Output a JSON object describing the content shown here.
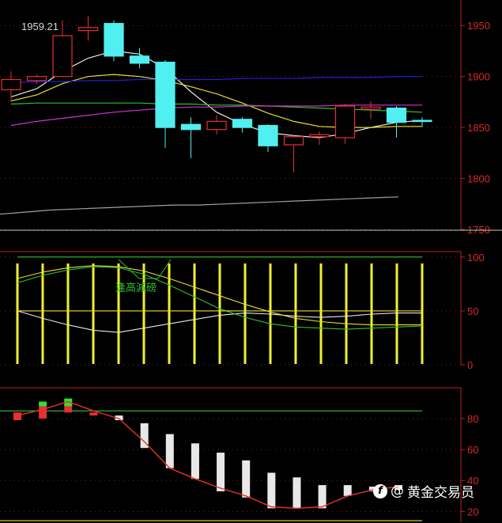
{
  "watermark": {
    "at": "@",
    "name": "黄金交易员",
    "logo_glyph": "f"
  },
  "colors": {
    "up_candle": "#e83030",
    "down_candle": "#50f0f0",
    "axis": "#c02020",
    "ma_white": "#e8e8e8",
    "ma_yellow": "#e8e030",
    "ma_blue": "#2020e0",
    "ma_green": "#30c030",
    "ma_magenta": "#d030d0",
    "ma_gray": "#a0a0a0"
  },
  "chart_data": [
    {
      "type": "candlestick",
      "title": "",
      "annotation": "1959.21",
      "ylim": [
        1750,
        1975
      ],
      "yticks": [
        1950,
        1900,
        1850,
        1800,
        1750
      ],
      "candles": [
        {
          "o": 1887,
          "h": 1905,
          "l": 1875,
          "c": 1897
        },
        {
          "o": 1896,
          "h": 1902,
          "l": 1893,
          "c": 1900
        },
        {
          "o": 1900,
          "h": 1955,
          "l": 1900,
          "c": 1940
        },
        {
          "o": 1945,
          "h": 1959.21,
          "l": 1935,
          "c": 1948
        },
        {
          "o": 1952,
          "h": 1955,
          "l": 1915,
          "c": 1920
        },
        {
          "o": 1920,
          "h": 1928,
          "l": 1908,
          "c": 1913
        },
        {
          "o": 1914,
          "h": 1916,
          "l": 1830,
          "c": 1850
        },
        {
          "o": 1853,
          "h": 1860,
          "l": 1820,
          "c": 1848
        },
        {
          "o": 1848,
          "h": 1862,
          "l": 1843,
          "c": 1856
        },
        {
          "o": 1858,
          "h": 1860,
          "l": 1845,
          "c": 1850
        },
        {
          "o": 1852,
          "h": 1853,
          "l": 1826,
          "c": 1832
        },
        {
          "o": 1833,
          "h": 1843,
          "l": 1806,
          "c": 1841
        },
        {
          "o": 1841,
          "h": 1846,
          "l": 1833,
          "c": 1843
        },
        {
          "o": 1840,
          "h": 1873,
          "l": 1834,
          "c": 1871
        },
        {
          "o": 1868,
          "h": 1876,
          "l": 1858,
          "c": 1870
        },
        {
          "o": 1869,
          "h": 1871,
          "l": 1840,
          "c": 1855
        },
        {
          "o": 1857,
          "h": 1860,
          "l": 1851,
          "c": 1856
        }
      ],
      "series": [
        {
          "color": "ma_white",
          "values": [
            1880,
            1888,
            1905,
            1918,
            1925,
            1922,
            1908,
            1885,
            1865,
            1853,
            1845,
            1842,
            1840,
            1844,
            1850,
            1855,
            1857
          ]
        },
        {
          "color": "ma_yellow",
          "values": [
            1876,
            1882,
            1893,
            1900,
            1902,
            1900,
            1896,
            1890,
            1883,
            1874,
            1864,
            1856,
            1851,
            1850,
            1850,
            1851,
            1851
          ]
        },
        {
          "color": "ma_blue",
          "values": [
            1894,
            1895,
            1895,
            1896,
            1896,
            1897,
            1897,
            1897,
            1897,
            1898,
            1898,
            1898,
            1899,
            1899,
            1899,
            1900,
            1900
          ]
        },
        {
          "color": "ma_green",
          "values": [
            1873,
            1874,
            1874,
            1874,
            1874,
            1874,
            1873,
            1873,
            1872,
            1872,
            1871,
            1870,
            1869,
            1868,
            1867,
            1866,
            1865
          ]
        },
        {
          "color": "ma_magenta",
          "values": [
            1852,
            1856,
            1859,
            1862,
            1865,
            1867,
            1869,
            1870,
            1870,
            1871,
            1871,
            1871,
            1871,
            1872,
            1872,
            1872,
            1872
          ]
        },
        {
          "color": "ma_gray",
          "values": [
            1765,
            1767,
            1769,
            1770,
            1771,
            1772,
            1773,
            1774,
            1774,
            1775,
            1776,
            1777,
            1778,
            1779,
            1780,
            1781,
            1782
          ]
        }
      ]
    },
    {
      "type": "bar",
      "title": "",
      "annotation": "逢高減磅",
      "ylim": [
        0,
        105
      ],
      "yticks": [
        100,
        50,
        0
      ],
      "bars": [
        94,
        94,
        94,
        94,
        94,
        94,
        94,
        94,
        94,
        94,
        94,
        94,
        94,
        94,
        94,
        94,
        94
      ],
      "series": [
        {
          "color": "ma_green",
          "values": [
            100,
            100,
            100,
            100,
            100,
            100,
            100,
            100,
            100,
            100,
            100,
            100,
            100,
            100,
            100,
            100,
            100
          ]
        },
        {
          "color": "ma_white",
          "values": [
            50,
            43,
            37,
            32,
            30,
            34,
            38,
            42,
            46,
            48,
            47,
            45,
            44,
            45,
            47,
            48,
            48
          ]
        },
        {
          "color": "ma_yellow",
          "values": [
            80,
            86,
            90,
            92,
            91,
            87,
            80,
            72,
            64,
            56,
            49,
            43,
            40,
            38,
            37,
            37,
            37
          ]
        },
        {
          "color": "ma_green",
          "values": [
            76,
            83,
            88,
            91,
            90,
            84,
            74,
            63,
            52,
            44,
            38,
            35,
            34,
            33,
            34,
            35,
            36
          ]
        },
        {
          "color": "ma_yellow",
          "values": [
            50,
            50,
            50,
            50,
            50,
            50,
            50,
            50,
            50,
            50,
            50,
            50,
            50,
            50,
            50,
            50,
            50
          ]
        }
      ]
    },
    {
      "type": "bar",
      "title": "",
      "ylim": [
        13,
        100
      ],
      "yticks": [
        80,
        60,
        40,
        20
      ],
      "hlines": [
        {
          "value": 85,
          "color": "ma_green"
        },
        {
          "value": 14,
          "color": "ma_yellow"
        }
      ],
      "bars": [
        {
          "top": 84,
          "bottom": 79,
          "color": "up_candle"
        },
        {
          "top": 88,
          "bottom": 80,
          "color": "up_candle"
        },
        {
          "top": 90,
          "bottom": 84,
          "color": "up_candle"
        },
        {
          "top": 84,
          "bottom": 82,
          "color": "up_candle"
        },
        {
          "top": 82,
          "bottom": 79,
          "color": "ma_white"
        },
        {
          "top": 77,
          "bottom": 61,
          "color": "ma_white"
        },
        {
          "top": 70,
          "bottom": 48,
          "color": "ma_white"
        },
        {
          "top": 64,
          "bottom": 41,
          "color": "ma_white"
        },
        {
          "top": 58,
          "bottom": 33,
          "color": "ma_white"
        },
        {
          "top": 53,
          "bottom": 29,
          "color": "ma_white"
        },
        {
          "top": 45,
          "bottom": 22,
          "color": "ma_white"
        },
        {
          "top": 42,
          "bottom": 22,
          "color": "ma_white"
        },
        {
          "top": 37,
          "bottom": 22,
          "color": "ma_white"
        },
        {
          "top": 37,
          "bottom": 30,
          "color": "ma_white"
        },
        {
          "top": 36,
          "bottom": 33,
          "color": "ma_white"
        },
        {
          "top": 37,
          "bottom": 34,
          "color": "ma_white"
        }
      ],
      "green_marks": [
        {
          "index": 1,
          "top": 91,
          "bottom": 88
        },
        {
          "index": 2,
          "top": 93,
          "bottom": 88
        }
      ],
      "series": [
        {
          "color": "up_candle",
          "values": [
            82,
            86,
            91,
            85,
            80,
            65,
            48,
            41,
            35,
            30,
            23,
            22,
            23,
            30,
            34,
            36
          ]
        }
      ]
    }
  ]
}
